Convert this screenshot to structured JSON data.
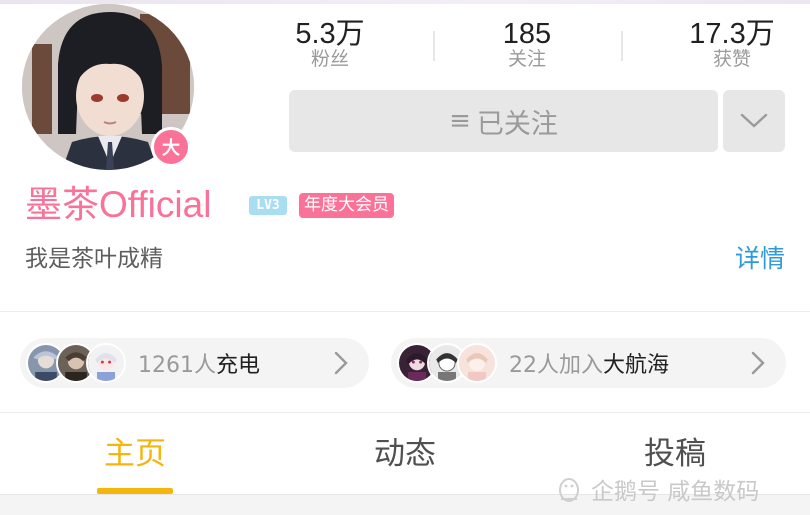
{
  "profile": {
    "name": "墨茶Official",
    "level": "LV3",
    "vip_tag": "年度大会员",
    "vip_badge": "大",
    "bio": "我是茶叶成精",
    "detail_link": "详情"
  },
  "stats": [
    {
      "value": "5.3万",
      "label": "粉丝"
    },
    {
      "value": "185",
      "label": "关注"
    },
    {
      "value": "17.3万",
      "label": "获赞"
    }
  ],
  "actions": {
    "follow_label": "已关注",
    "follow_icon": "menu-icon",
    "more_icon": "chevron-down-icon"
  },
  "supporters": {
    "charge": {
      "count": "1261人",
      "label": "充电"
    },
    "guard": {
      "count": "22人加入",
      "label": "大航海"
    }
  },
  "tabs": [
    {
      "label": "主页",
      "active": true
    },
    {
      "label": "动态",
      "active": false
    },
    {
      "label": "投稿",
      "active": false
    }
  ],
  "watermark": "企鹅号 咸鱼数码",
  "colors": {
    "brand_pink": "#fb7299",
    "tab_active": "#f5b50a",
    "link_blue": "#2f9bd6",
    "level_blue": "#a9ddf2"
  }
}
